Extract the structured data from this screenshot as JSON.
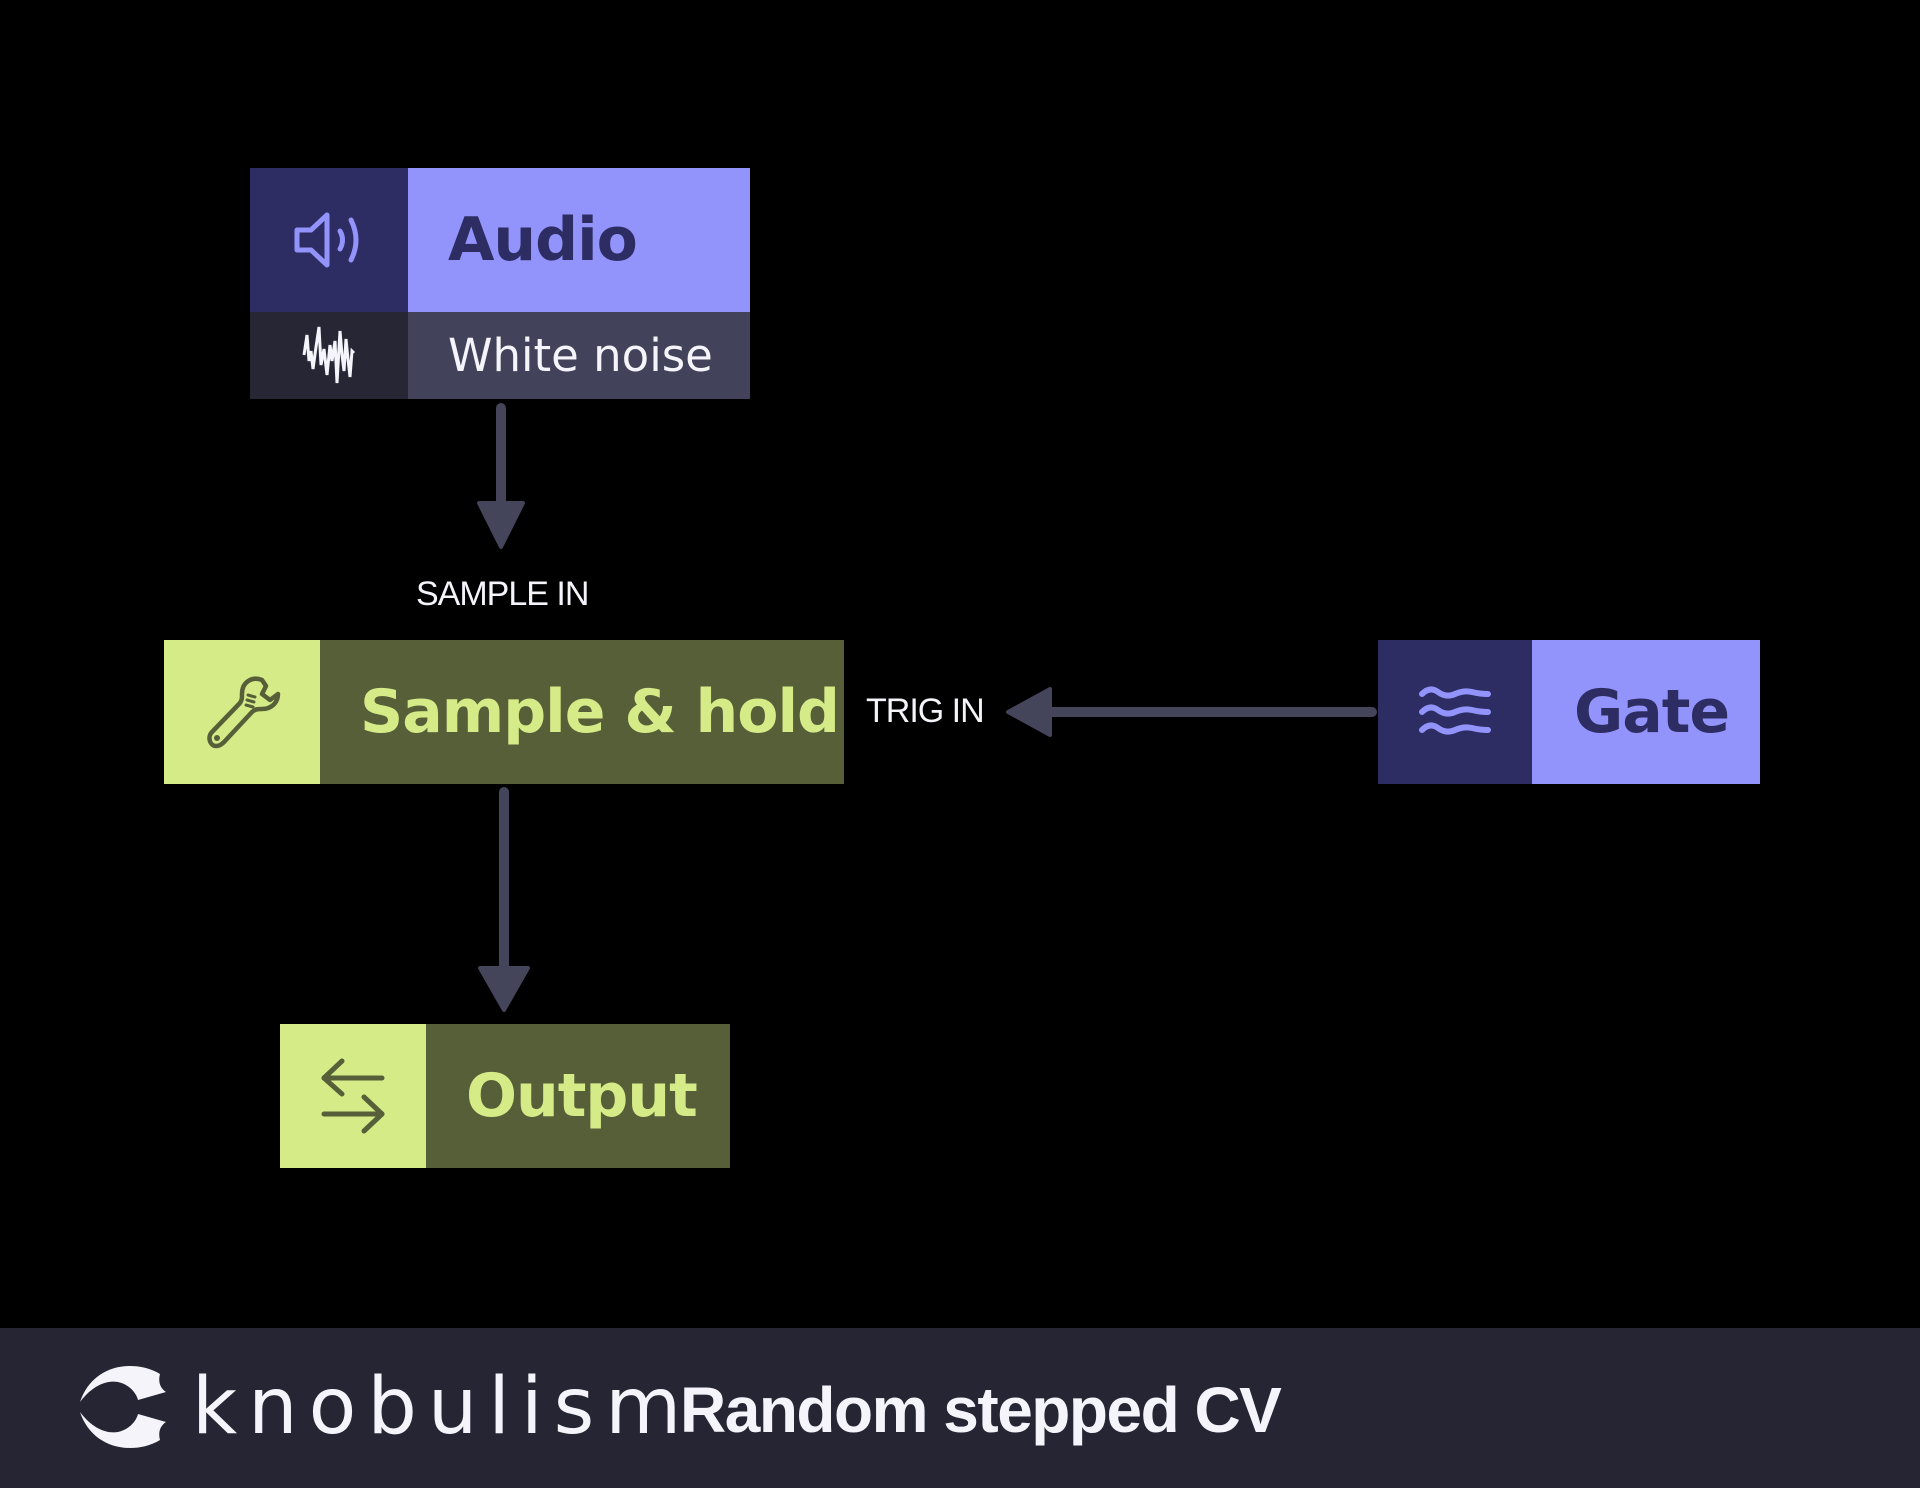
{
  "diagram": {
    "title": "Random stepped CV",
    "nodes": {
      "audio": {
        "title": "Audio",
        "subtitle": "White noise",
        "icon": "speaker-icon",
        "subtitle_icon": "noise-waveform-icon"
      },
      "sample_hold": {
        "title": "Sample & hold",
        "icon": "wrench-icon"
      },
      "gate": {
        "title": "Gate",
        "icon": "waves-icon"
      },
      "output": {
        "title": "Output",
        "icon": "swap-arrows-icon"
      }
    },
    "ports": {
      "sample_in": "SAMPLE IN",
      "trig_in": "TRIG IN"
    },
    "connections": [
      {
        "from": "Audio",
        "to": "Sample & hold",
        "port": "SAMPLE IN"
      },
      {
        "from": "Gate",
        "to": "Sample & hold",
        "port": "TRIG IN"
      },
      {
        "from": "Sample & hold",
        "to": "Output",
        "port": ""
      }
    ]
  },
  "footer": {
    "brand": "knobulism",
    "logo_icon": "knobulism-logo-icon"
  },
  "colors": {
    "background": "#000000",
    "footer_bg": "#252534",
    "source_dark": "#2d2d63",
    "source_light": "#9294fc",
    "module_light": "#d5eb88",
    "module_dark": "#575f38",
    "subtitle_bg": "#42425a",
    "subtitle_icon_bg": "#262635",
    "connector": "#44445a",
    "text_light": "#f4f4fa"
  }
}
